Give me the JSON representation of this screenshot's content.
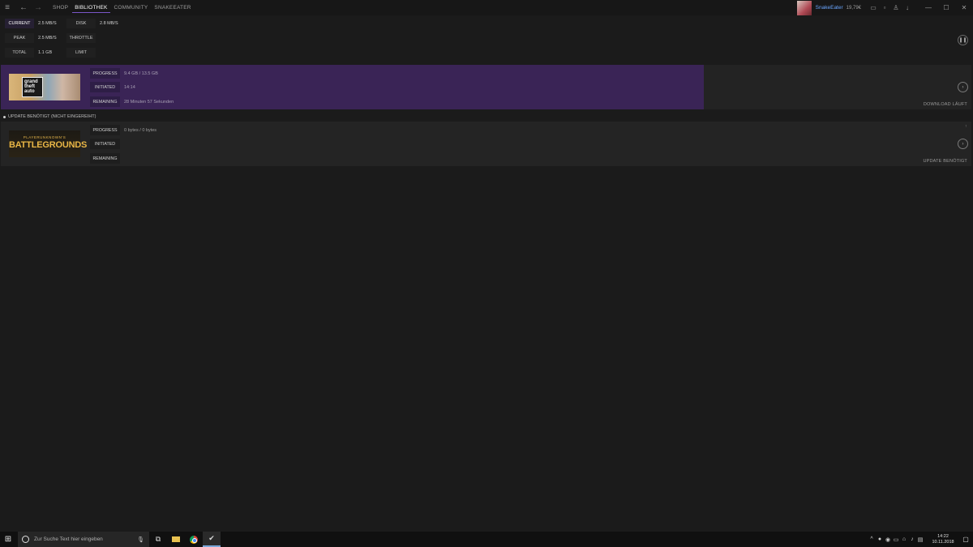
{
  "nav": {
    "menu_icon": "hamburger-icon",
    "back_icon": "arrow-left-icon",
    "forward_icon": "arrow-right-icon",
    "links": [
      "SHOP",
      "BIBLIOTHEK",
      "COMMUNITY",
      "SNAKEEATER"
    ],
    "active": "BIBLIOTHEK"
  },
  "account": {
    "username": "SnakeEater",
    "wallet": "19,79€"
  },
  "window": {
    "minimize": "—",
    "maximize": "☐",
    "close": "✕"
  },
  "stats": {
    "current_label": "CURRENT",
    "current_value": "2.5 MB/S",
    "peak_label": "PEAK",
    "peak_value": "2.5 MB/S",
    "total_label": "TOTAL",
    "total_value": "1.1 GB",
    "disk_label": "DISK",
    "disk_value": "2.8 MB/S",
    "throttle_label": "THROTTLE",
    "limit_label": "LIMIT"
  },
  "downloads": [
    {
      "game": "Grand Theft Auto V",
      "logo_text": "grand theft auto",
      "progress_label": "PROGRESS",
      "progress_value": "9.4 GB / 13.5 GB",
      "progress_fraction": 0.7,
      "initiated_label": "INITIATED",
      "initiated_value": "14:14",
      "remaining_label": "REMAINING",
      "remaining_value": "28 Minuten 57 Sekunden",
      "status": "DOWNLOAD LÄUFT"
    },
    {
      "game": "PlayerUnknown's Battlegrounds",
      "logo_small": "PLAYERUNKNOWN'S",
      "logo_big": "BATTLEGROUNDS",
      "progress_label": "PROGRESS",
      "progress_value": "0 bytes / 0 bytes",
      "initiated_label": "INITIATED",
      "remaining_label": "REMAINING",
      "status": "UPDATE BENÖTIGT"
    }
  ],
  "queue_header": "UPDATE BENÖTIGT (NICHT EINGEREIHT)",
  "taskbar": {
    "search_placeholder": "Zur Suche Text hier eingeben",
    "time": "14:22",
    "date": "10.11.2018"
  }
}
